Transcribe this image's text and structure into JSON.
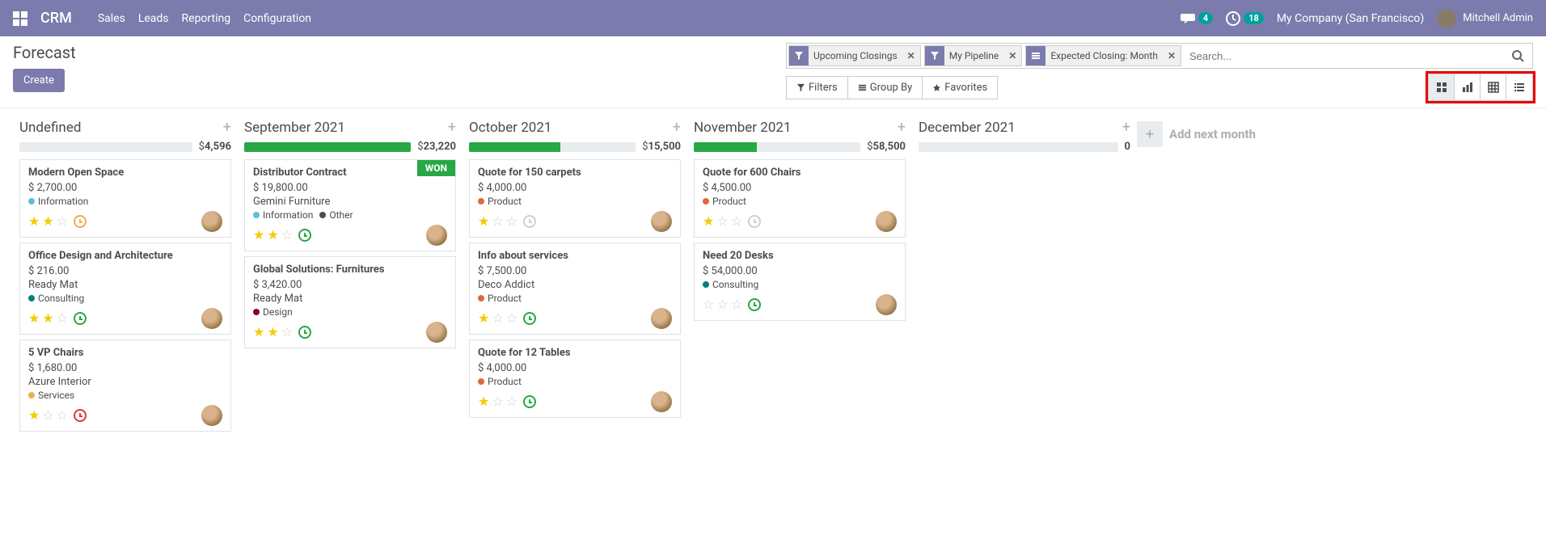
{
  "navbar": {
    "brand": "CRM",
    "menu": [
      "Sales",
      "Leads",
      "Reporting",
      "Configuration"
    ],
    "discuss_badge": "4",
    "activities_badge": "18",
    "company": "My Company (San Francisco)",
    "user": "Mitchell Admin"
  },
  "header": {
    "breadcrumb": "Forecast",
    "create_label": "Create",
    "search": {
      "placeholder": "Search...",
      "facets": [
        {
          "icon": "filter",
          "label": "Upcoming Closings"
        },
        {
          "icon": "filter",
          "label": "My Pipeline"
        },
        {
          "icon": "groupby",
          "label": "Expected Closing: Month"
        }
      ]
    },
    "toolbar": {
      "filters": "Filters",
      "groupby": "Group By",
      "favorites": "Favorites"
    },
    "add_next_month": "Add next month"
  },
  "columns": [
    {
      "title": "Undefined",
      "total": "$4,596",
      "progress": [
        {
          "pct": 0,
          "color": "#28a745"
        }
      ],
      "cards": [
        {
          "title": "Modern Open Space",
          "amount": "$ 2,700.00",
          "subtitle": "",
          "tags": [
            {
              "label": "Information",
              "color": "#5bc0de"
            }
          ],
          "stars": 2,
          "activity": "warning",
          "won": false
        },
        {
          "title": "Office Design and Architecture",
          "amount": "$ 216.00",
          "subtitle": "Ready Mat",
          "tags": [
            {
              "label": "Consulting",
              "color": "#008080"
            }
          ],
          "stars": 2,
          "activity": "success",
          "won": false
        },
        {
          "title": "5 VP Chairs",
          "amount": "$ 1,680.00",
          "subtitle": "Azure Interior",
          "tags": [
            {
              "label": "Services",
              "color": "#f0ad4e"
            }
          ],
          "stars": 1,
          "activity": "danger",
          "won": false
        }
      ]
    },
    {
      "title": "September 2021",
      "total": "$23,220",
      "progress": [
        {
          "pct": 100,
          "color": "#28a745"
        }
      ],
      "cards": [
        {
          "title": "Distributor Contract",
          "amount": "$ 19,800.00",
          "subtitle": "Gemini Furniture",
          "tags": [
            {
              "label": "Information",
              "color": "#5bc0de"
            },
            {
              "label": "Other",
              "color": "#4c4c4c"
            }
          ],
          "stars": 2,
          "activity": "success",
          "won": true
        },
        {
          "title": "Global Solutions: Furnitures",
          "amount": "$ 3,420.00",
          "subtitle": "Ready Mat",
          "tags": [
            {
              "label": "Design",
              "color": "#800040"
            }
          ],
          "stars": 2,
          "activity": "success",
          "won": false
        }
      ]
    },
    {
      "title": "October 2021",
      "total": "$15,500",
      "progress": [
        {
          "pct": 55,
          "color": "#28a745"
        }
      ],
      "cards": [
        {
          "title": "Quote for 150 carpets",
          "amount": "$ 4,000.00",
          "subtitle": "",
          "tags": [
            {
              "label": "Product",
              "color": "#dc6b3c"
            }
          ],
          "stars": 1,
          "activity": "muted",
          "won": false
        },
        {
          "title": "Info about services",
          "amount": "$ 7,500.00",
          "subtitle": "Deco Addict",
          "tags": [
            {
              "label": "Product",
              "color": "#dc6b3c"
            }
          ],
          "stars": 1,
          "activity": "success",
          "won": false
        },
        {
          "title": "Quote for 12 Tables",
          "amount": "$ 4,000.00",
          "subtitle": "",
          "tags": [
            {
              "label": "Product",
              "color": "#dc6b3c"
            }
          ],
          "stars": 1,
          "activity": "success",
          "won": false
        }
      ]
    },
    {
      "title": "November 2021",
      "total": "$58,500",
      "progress": [
        {
          "pct": 38,
          "color": "#28a745"
        }
      ],
      "cards": [
        {
          "title": "Quote for 600 Chairs",
          "amount": "$ 4,500.00",
          "subtitle": "",
          "tags": [
            {
              "label": "Product",
              "color": "#dc6b3c"
            }
          ],
          "stars": 1,
          "activity": "muted",
          "won": false
        },
        {
          "title": "Need 20 Desks",
          "amount": "$ 54,000.00",
          "subtitle": "",
          "tags": [
            {
              "label": "Consulting",
              "color": "#008080"
            }
          ],
          "stars": 0,
          "activity": "success",
          "won": false
        }
      ]
    },
    {
      "title": "December 2021",
      "total": "0",
      "progress": [
        {
          "pct": 0,
          "color": "#28a745"
        }
      ],
      "cards": []
    }
  ]
}
